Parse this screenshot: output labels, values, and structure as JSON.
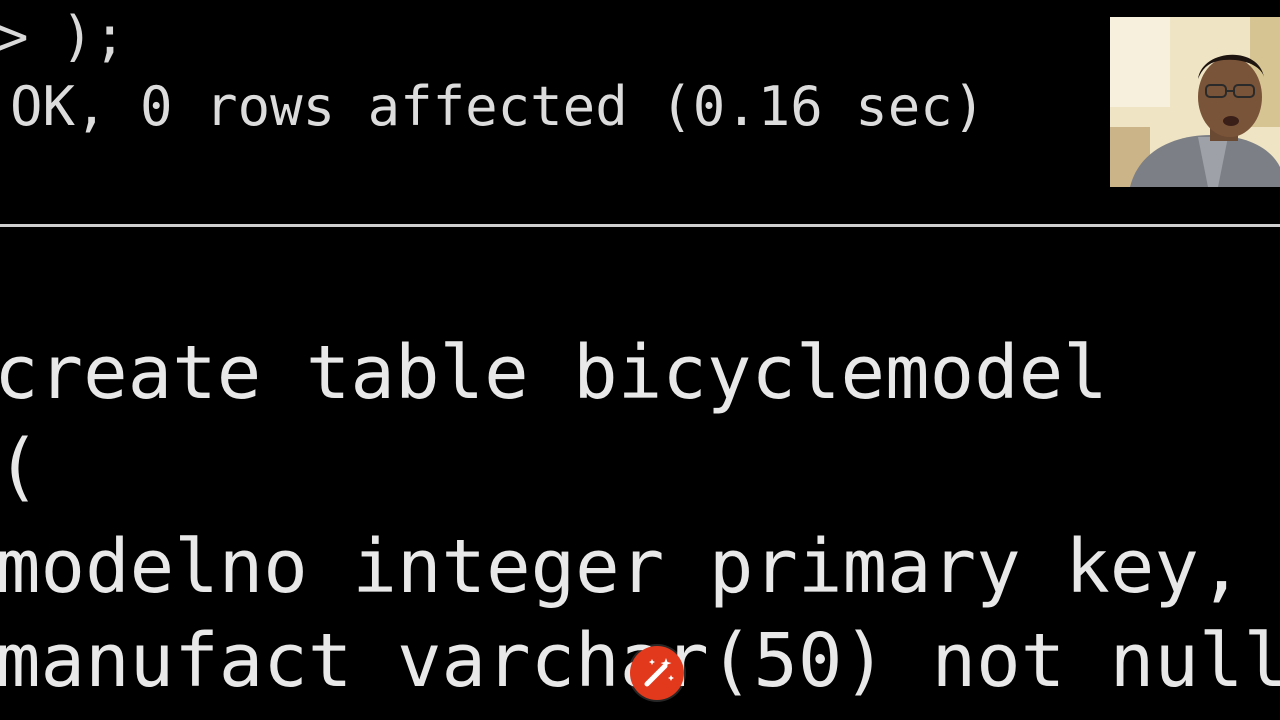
{
  "console": {
    "previous_line": "> );",
    "result_line": "OK, 0 rows affected (0.16 sec)"
  },
  "sql": {
    "lines": [
      "create table bicyclemodel",
      "(",
      "modelno integer primary key,",
      "manufact varchar(50) not null"
    ]
  },
  "webcam": {
    "icon": "webcam-presenter-icon"
  },
  "cursor": {
    "icon": "magic-wand-icon",
    "color": "#e2391c"
  },
  "colors": {
    "background": "#000000",
    "text": "#e8e8e8",
    "divider": "#cfcfcf"
  }
}
